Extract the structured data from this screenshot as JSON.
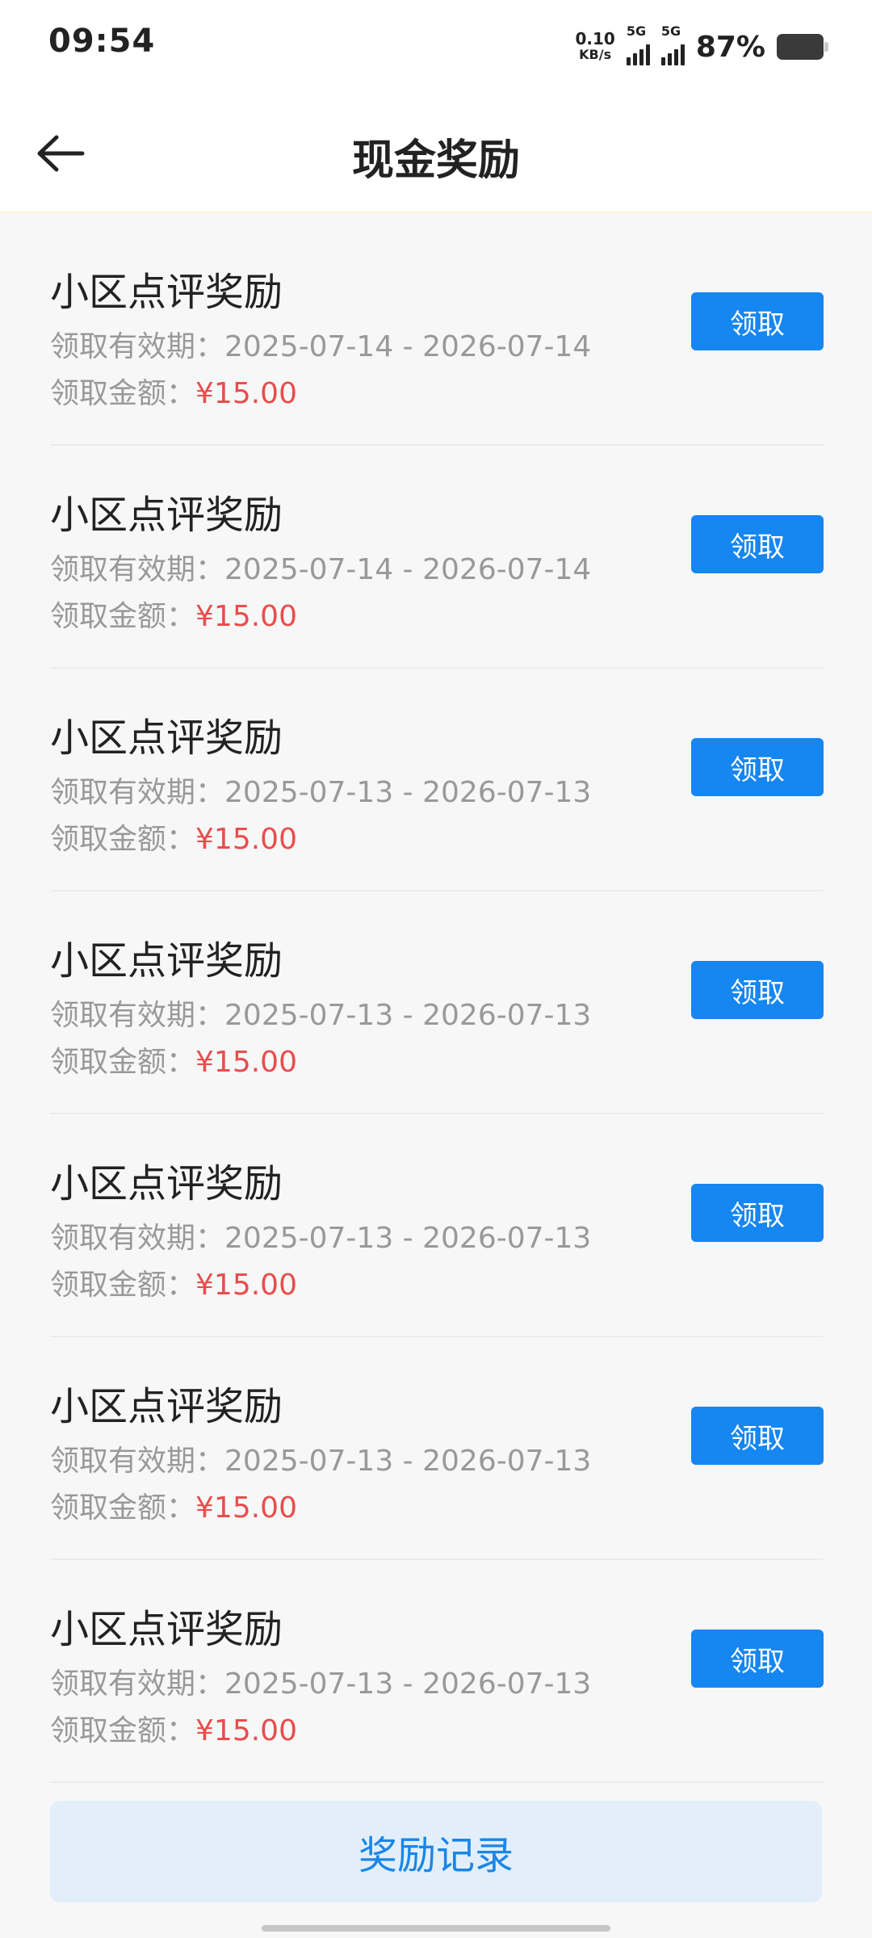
{
  "status_bar": {
    "time": "09:54",
    "net_speed_value": "0.10",
    "net_speed_unit": "KB/s",
    "signal1_label": "5G",
    "signal2_label": "5G",
    "battery_percent": "87%"
  },
  "header": {
    "title": "现金奖励"
  },
  "rewards": [
    {
      "title": "小区点评奖励",
      "period_label": "领取有效期：",
      "period": "2025-07-14 - 2026-07-14",
      "amount_label": "领取金额：",
      "amount": "¥15.00",
      "button": "领取"
    },
    {
      "title": "小区点评奖励",
      "period_label": "领取有效期：",
      "period": "2025-07-14 - 2026-07-14",
      "amount_label": "领取金额：",
      "amount": "¥15.00",
      "button": "领取"
    },
    {
      "title": "小区点评奖励",
      "period_label": "领取有效期：",
      "period": "2025-07-13 - 2026-07-13",
      "amount_label": "领取金额：",
      "amount": "¥15.00",
      "button": "领取"
    },
    {
      "title": "小区点评奖励",
      "period_label": "领取有效期：",
      "period": "2025-07-13 - 2026-07-13",
      "amount_label": "领取金额：",
      "amount": "¥15.00",
      "button": "领取"
    },
    {
      "title": "小区点评奖励",
      "period_label": "领取有效期：",
      "period": "2025-07-13 - 2026-07-13",
      "amount_label": "领取金额：",
      "amount": "¥15.00",
      "button": "领取"
    },
    {
      "title": "小区点评奖励",
      "period_label": "领取有效期：",
      "period": "2025-07-13 - 2026-07-13",
      "amount_label": "领取金额：",
      "amount": "¥15.00",
      "button": "领取"
    },
    {
      "title": "小区点评奖励",
      "period_label": "领取有效期：",
      "period": "2025-07-13 - 2026-07-13",
      "amount_label": "领取金额：",
      "amount": "¥15.00",
      "button": "领取"
    }
  ],
  "footer": {
    "record_button": "奖励记录"
  },
  "colors": {
    "accent": "#1686f0",
    "money": "#e84d4d",
    "record_bg": "#e2effb"
  }
}
